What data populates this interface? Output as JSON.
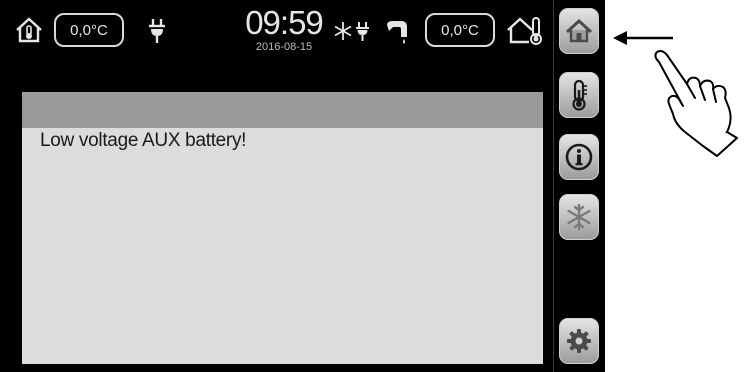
{
  "status_bar": {
    "indoor_temp": "0,0°C",
    "time": "09:59",
    "date": "2016-08-15",
    "outdoor_temp": "0,0°C",
    "icons": [
      "house-thermometer-icon",
      "plug-icon",
      "snowflake-plug-icon",
      "tap-icon",
      "house-outline-thermometer-icon"
    ]
  },
  "alarm": {
    "message": "Low voltage AUX battery!"
  },
  "sidebar": {
    "buttons": [
      "home-icon",
      "thermometer-icon",
      "info-icon",
      "snowflake-icon",
      "gear-icon"
    ]
  },
  "annotation": {
    "icons": [
      "arrow-left-icon",
      "pointing-hand-icon"
    ]
  },
  "colors": {
    "screen_background": "#000000",
    "alarm_panel": "#dcdcdc",
    "alarm_header": "#9a9a9a",
    "button_face": "#c8c8c8"
  }
}
